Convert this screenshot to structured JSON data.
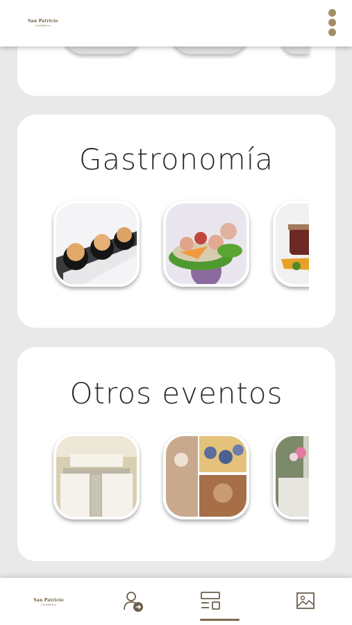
{
  "header": {
    "brand_name": "San Patricio",
    "brand_sub": "Cantábrico"
  },
  "sections": [
    {
      "title": "Gastronomía"
    },
    {
      "title": "Otros eventos"
    }
  ],
  "nav": {
    "items": [
      "home",
      "profile",
      "events",
      "gallery"
    ],
    "active": "events"
  },
  "colors": {
    "accent": "#a28d66",
    "brand": "#6e5a38",
    "background": "#e9e9e9"
  }
}
